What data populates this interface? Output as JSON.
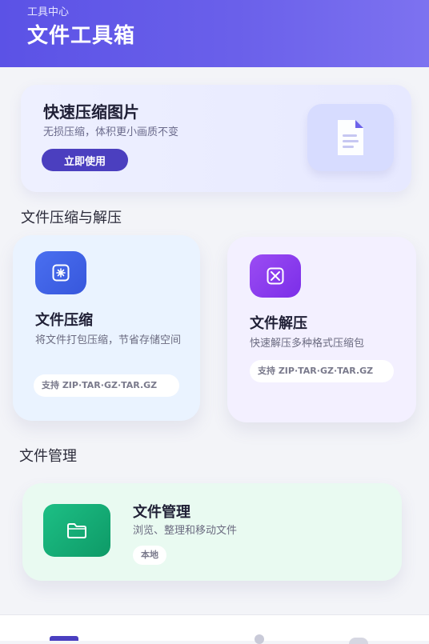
{
  "header": {
    "subtitle": "工具中心",
    "title": "文件工具箱"
  },
  "promo": {
    "title": "快速压缩图片",
    "subtitle": "无损压缩，体积更小画质不变",
    "button": "立即使用"
  },
  "sections": {
    "compress_title": "文件压缩与解压",
    "manage_title": "文件管理"
  },
  "cards": {
    "compress": {
      "title": "文件压缩",
      "desc": "将文件打包压缩，节省存储空间",
      "pill": "支持 ZIP·TAR·GZ·TAR.GZ"
    },
    "decompress": {
      "title": "文件解压",
      "desc": "快速解压多种格式压缩包",
      "pill": "支持 ZIP·TAR·GZ·TAR.GZ"
    },
    "manage": {
      "title": "文件管理",
      "desc": "浏览、整理和移动文件",
      "pill": "本地"
    }
  },
  "colors": {
    "accent": "#5b52e6",
    "compress_badge": "#3f62e8",
    "decompress_badge": "#8a3df0",
    "manage_badge": "#13a36f"
  },
  "icons": {
    "promo": "document-icon",
    "compress": "compress-icon",
    "decompress": "decompress-icon",
    "manage": "folder-icon"
  }
}
